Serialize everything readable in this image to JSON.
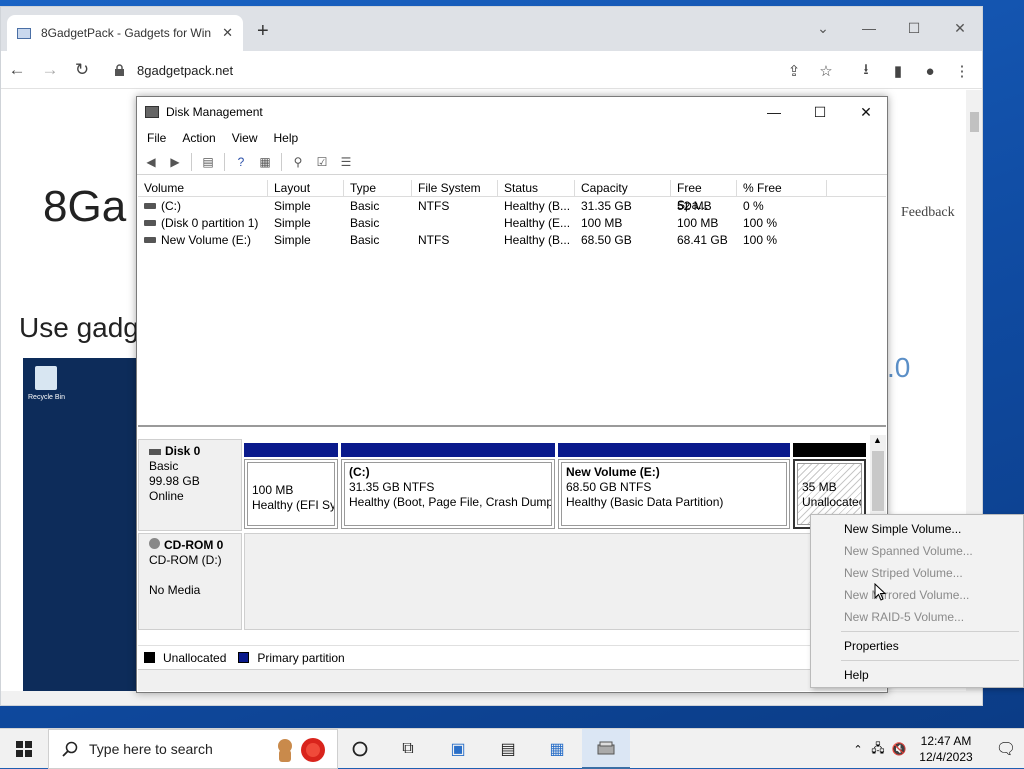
{
  "browser": {
    "tab_title": "8GadgetPack - Gadgets for Win",
    "url": "8gadgetpack.net"
  },
  "webpage": {
    "title": "8Ga",
    "subtitle": "Use gadg",
    "feedback": "Feedback",
    "version_fragment": ".0",
    "recycle_bin_label": "Recycle Bin"
  },
  "dm": {
    "title": "Disk Management",
    "menu": [
      "File",
      "Action",
      "View",
      "Help"
    ],
    "columns": [
      "Volume",
      "Layout",
      "Type",
      "File System",
      "Status",
      "Capacity",
      "Free Spa...",
      "% Free"
    ],
    "volumes": [
      {
        "volume": "(C:)",
        "layout": "Simple",
        "type": "Basic",
        "fs": "NTFS",
        "status": "Healthy (B...",
        "capacity": "31.35 GB",
        "free": "52 MB",
        "pct": "0 %"
      },
      {
        "volume": "(Disk 0 partition 1)",
        "layout": "Simple",
        "type": "Basic",
        "fs": "",
        "status": "Healthy (E...",
        "capacity": "100 MB",
        "free": "100 MB",
        "pct": "100 %"
      },
      {
        "volume": "New Volume (E:)",
        "layout": "Simple",
        "type": "Basic",
        "fs": "NTFS",
        "status": "Healthy (B...",
        "capacity": "68.50 GB",
        "free": "68.41 GB",
        "pct": "100 %"
      }
    ],
    "disk0": {
      "name": "Disk 0",
      "type": "Basic",
      "size": "99.98 GB",
      "state": "Online"
    },
    "partitions": [
      {
        "name": "",
        "size": "100 MB",
        "status": "Healthy (EFI Sys"
      },
      {
        "name": "(C:)",
        "size": "31.35 GB NTFS",
        "status": "Healthy (Boot, Page File, Crash Dump,"
      },
      {
        "name": "New Volume  (E:)",
        "size": "68.50 GB NTFS",
        "status": "Healthy (Basic Data Partition)"
      },
      {
        "name": "",
        "size": "35 MB",
        "status": "Unallocatec"
      }
    ],
    "cdrom": {
      "name": "CD-ROM 0",
      "type": "CD-ROM (D:)",
      "media": "No Media"
    },
    "legend": {
      "unallocated": "Unallocated",
      "primary": "Primary partition"
    },
    "colors": {
      "primary": "#0a1a8c",
      "unallocated": "#000000"
    }
  },
  "context_menu": {
    "items": [
      {
        "label": "New Simple Volume...",
        "enabled": true
      },
      {
        "label": "New Spanned Volume...",
        "enabled": false
      },
      {
        "label": "New Striped Volume...",
        "enabled": false
      },
      {
        "label": "New Mirrored Volume...",
        "enabled": false
      },
      {
        "label": "New RAID-5 Volume...",
        "enabled": false
      }
    ],
    "properties": "Properties",
    "help": "Help"
  },
  "taskbar": {
    "search_placeholder": "Type here to search",
    "time": "12:47 AM",
    "date": "12/4/2023"
  }
}
